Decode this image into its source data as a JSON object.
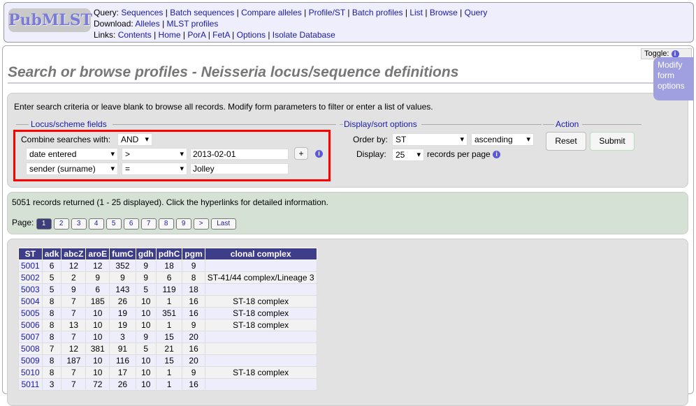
{
  "header": {
    "logo": "PubMLST",
    "query_label": "Query:",
    "query_links": [
      "Sequences",
      "Batch sequences",
      "Compare alleles",
      "Profile/ST",
      "Batch profiles",
      "List",
      "Browse",
      "Query"
    ],
    "download_label": "Download:",
    "download_links": [
      "Alleles",
      "MLST profiles"
    ],
    "links_label": "Links:",
    "links": [
      "Contents",
      "Home",
      "PorA",
      "FetA",
      "Options",
      "Isolate Database"
    ]
  },
  "toggle": "Toggle:",
  "title": "Search or browse profiles - Neisseria locus/sequence definitions",
  "form": {
    "intro": "Enter search criteria or leave blank to browse all records. Modify form parameters to filter or enter a list of values.",
    "locus_legend": "Locus/scheme fields",
    "combine_label": "Combine searches with:",
    "combine_value": "AND",
    "rows": [
      {
        "field": "date entered",
        "op": ">",
        "value": "2013-02-01"
      },
      {
        "field": "sender (surname)",
        "op": "=",
        "value": "Jolley"
      }
    ],
    "add_label": "+",
    "display_legend": "Display/sort options",
    "order_label": "Order by:",
    "order_value": "ST",
    "direction": "ascending",
    "display_label": "Display:",
    "display_value": "25",
    "per_page": "records per page",
    "action_legend": "Action",
    "reset": "Reset",
    "submit": "Submit"
  },
  "modify_tab": "Modify form options",
  "results": {
    "summary": "5051 records returned (1 - 25 displayed). Click the hyperlinks for detailed information.",
    "page_label": "Page:",
    "pages": [
      "1",
      "2",
      "3",
      "4",
      "5",
      "6",
      "7",
      "8",
      "9",
      ">",
      "Last"
    ],
    "current_page": "1"
  },
  "table": {
    "headers": [
      "ST",
      "adk",
      "abcZ",
      "aroE",
      "fumC",
      "gdh",
      "pdhC",
      "pgm",
      "clonal complex"
    ],
    "rows": [
      [
        "5001",
        "6",
        "12",
        "12",
        "352",
        "9",
        "18",
        "9",
        ""
      ],
      [
        "5002",
        "5",
        "2",
        "9",
        "9",
        "9",
        "6",
        "8",
        "ST-41/44 complex/Lineage 3"
      ],
      [
        "5003",
        "5",
        "9",
        "6",
        "143",
        "5",
        "119",
        "18",
        ""
      ],
      [
        "5004",
        "8",
        "7",
        "185",
        "26",
        "10",
        "1",
        "16",
        "ST-18 complex"
      ],
      [
        "5005",
        "8",
        "7",
        "10",
        "19",
        "10",
        "351",
        "16",
        "ST-18 complex"
      ],
      [
        "5006",
        "8",
        "13",
        "10",
        "19",
        "10",
        "1",
        "9",
        "ST-18 complex"
      ],
      [
        "5007",
        "8",
        "7",
        "10",
        "3",
        "9",
        "15",
        "20",
        ""
      ],
      [
        "5008",
        "7",
        "12",
        "381",
        "91",
        "5",
        "21",
        "16",
        ""
      ],
      [
        "5009",
        "8",
        "187",
        "10",
        "116",
        "10",
        "15",
        "20",
        ""
      ],
      [
        "5010",
        "8",
        "7",
        "10",
        "17",
        "10",
        "1",
        "9",
        "ST-18 complex"
      ],
      [
        "5011",
        "3",
        "7",
        "72",
        "26",
        "10",
        "1",
        "16",
        ""
      ]
    ]
  },
  "colors": {
    "highlight": "#ff0000",
    "table_header": "#3d3d8a"
  }
}
